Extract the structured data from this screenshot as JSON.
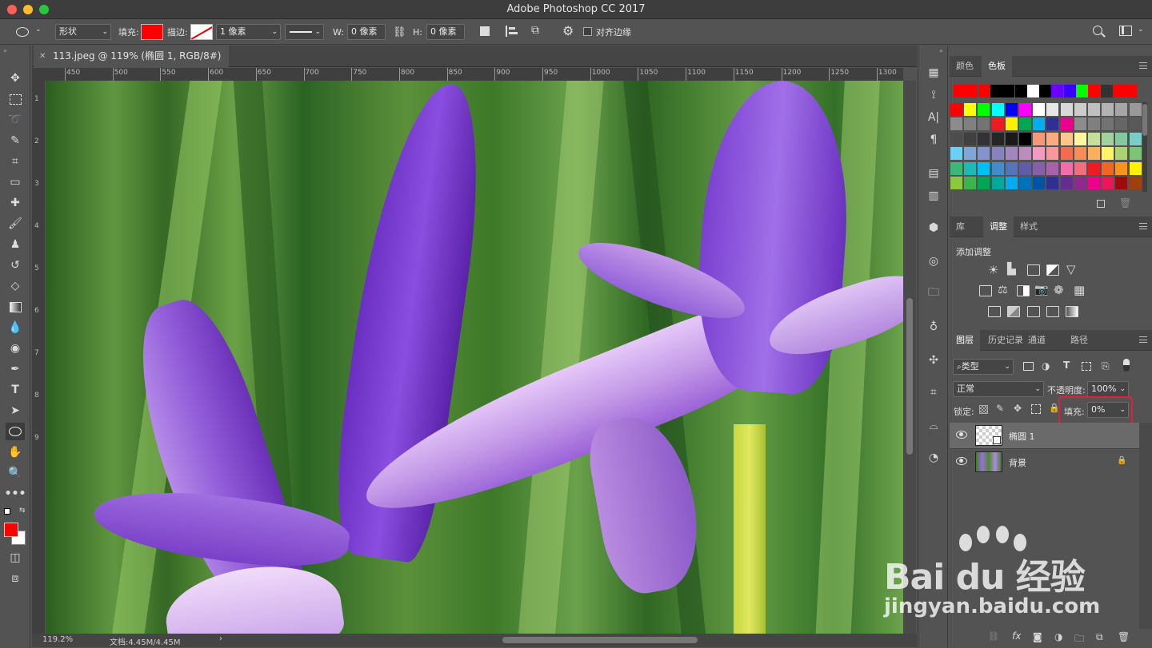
{
  "window": {
    "title": "Adobe Photoshop CC 2017"
  },
  "options": {
    "mode": "形状",
    "fill_label": "填充:",
    "fill_color": "#ff0000",
    "stroke_label": "描边:",
    "stroke_width": "1 像素",
    "w_label": "W:",
    "w_value": "0 像素",
    "h_label": "H:",
    "h_value": "0 像素",
    "align_edges": "对齐边缘"
  },
  "document": {
    "tab_title": "113.jpeg @ 119% (椭圆 1, RGB/8#) *",
    "ruler_ticks": [
      "450",
      "500",
      "550",
      "600",
      "650",
      "700",
      "750",
      "800",
      "850",
      "900",
      "950",
      "1000",
      "1050",
      "1100",
      "1150",
      "1200",
      "1250",
      "1300"
    ],
    "vruler_ticks": [
      "1",
      "2",
      "3",
      "4",
      "5",
      "6",
      "7",
      "8",
      "9"
    ],
    "zoom": "119.2%",
    "doc_size": "文档:4.45M/4.45M"
  },
  "swatches_panel": {
    "tabs": [
      "颜色",
      "色板"
    ],
    "active": "色板",
    "row0": [
      "#ff0000",
      "#ff0000",
      "#ff0000",
      "#000000",
      "#000000",
      "#000000",
      "#ffffff",
      "#000000",
      "#6a00ff",
      "#3a00ff",
      "#00ff00",
      "#ff0000",
      "#333333",
      "#ff0000",
      "#ff0000"
    ],
    "grid": [
      [
        "#ff0000",
        "#ffff00",
        "#00ff00",
        "#00ffff",
        "#0000ff",
        "#ff00ff",
        "#ffffff",
        "#e6e6e6",
        "#d9d9d9",
        "#cccccc",
        "#bfbfbf",
        "#b3b3b3",
        "#a6a6a6",
        "#999999"
      ],
      [
        "#8c8c8c",
        "#808080",
        "#737373",
        "#ed1c24",
        "#fff200",
        "#00a651",
        "#00aeef",
        "#2e3192",
        "#ec008c",
        "#8c8c8c",
        "#7f7f7f",
        "#737373",
        "#666666",
        "#595959"
      ],
      [
        "#4d4d4d",
        "#404040",
        "#333333",
        "#262626",
        "#1a1a1a",
        "#000000",
        "#f7977a",
        "#f9ad81",
        "#fdc68a",
        "#fff79a",
        "#c4df9b",
        "#a3d39c",
        "#82ca9d",
        "#7bcdc8"
      ],
      [
        "#6ecff6",
        "#7ea7d8",
        "#8493ca",
        "#8882be",
        "#a187be",
        "#bc8dbf",
        "#f49ac2",
        "#f6989d",
        "#f26c4f",
        "#f68e56",
        "#fbaf5d",
        "#fff467",
        "#acd372",
        "#7cc576"
      ],
      [
        "#3bb878",
        "#1abbb4",
        "#00bff3",
        "#438cca",
        "#5574b9",
        "#605ca8",
        "#855fa8",
        "#a763a8",
        "#f06eaa",
        "#f26d7d",
        "#ed1c24",
        "#f26522",
        "#f7941d",
        "#fff200"
      ],
      [
        "#8dc73f",
        "#39b54a",
        "#00a651",
        "#00a99d",
        "#00aeef",
        "#0072bc",
        "#0054a6",
        "#2e3192",
        "#662d91",
        "#92278f",
        "#ec008c",
        "#ed145b",
        "#9e0b0f",
        "#a0410d"
      ]
    ]
  },
  "adjustments_panel": {
    "tabs": [
      "库",
      "调整",
      "样式"
    ],
    "active": "调整",
    "heading": "添加调整"
  },
  "layers_panel": {
    "tabs": [
      "图层",
      "历史记录",
      "通道",
      "路径"
    ],
    "active": "图层",
    "filter": "类型",
    "blend_mode": "正常",
    "opacity_label": "不透明度:",
    "opacity": "100%",
    "lock_label": "锁定:",
    "fill_label": "填充:",
    "fill": "0%",
    "layers": [
      {
        "name": "椭圆 1"
      },
      {
        "name": "背景"
      }
    ]
  },
  "watermark": {
    "brand": "Bai du 经验",
    "url": "jingyan.baidu.com"
  }
}
